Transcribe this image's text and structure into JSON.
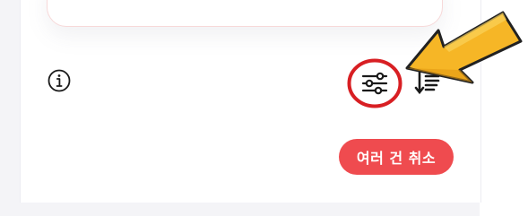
{
  "toolbar": {
    "info_icon": "info-icon",
    "filter_icon": "sliders-filter-icon",
    "sort_icon": "sort-order-icon"
  },
  "actions": {
    "cancel_multiple_label": "여러 건 취소"
  },
  "colors": {
    "accent_red": "#ef4b4f",
    "highlight_ring": "#d81f23",
    "arrow_fill": "#f6b626",
    "arrow_stroke": "#222222"
  }
}
